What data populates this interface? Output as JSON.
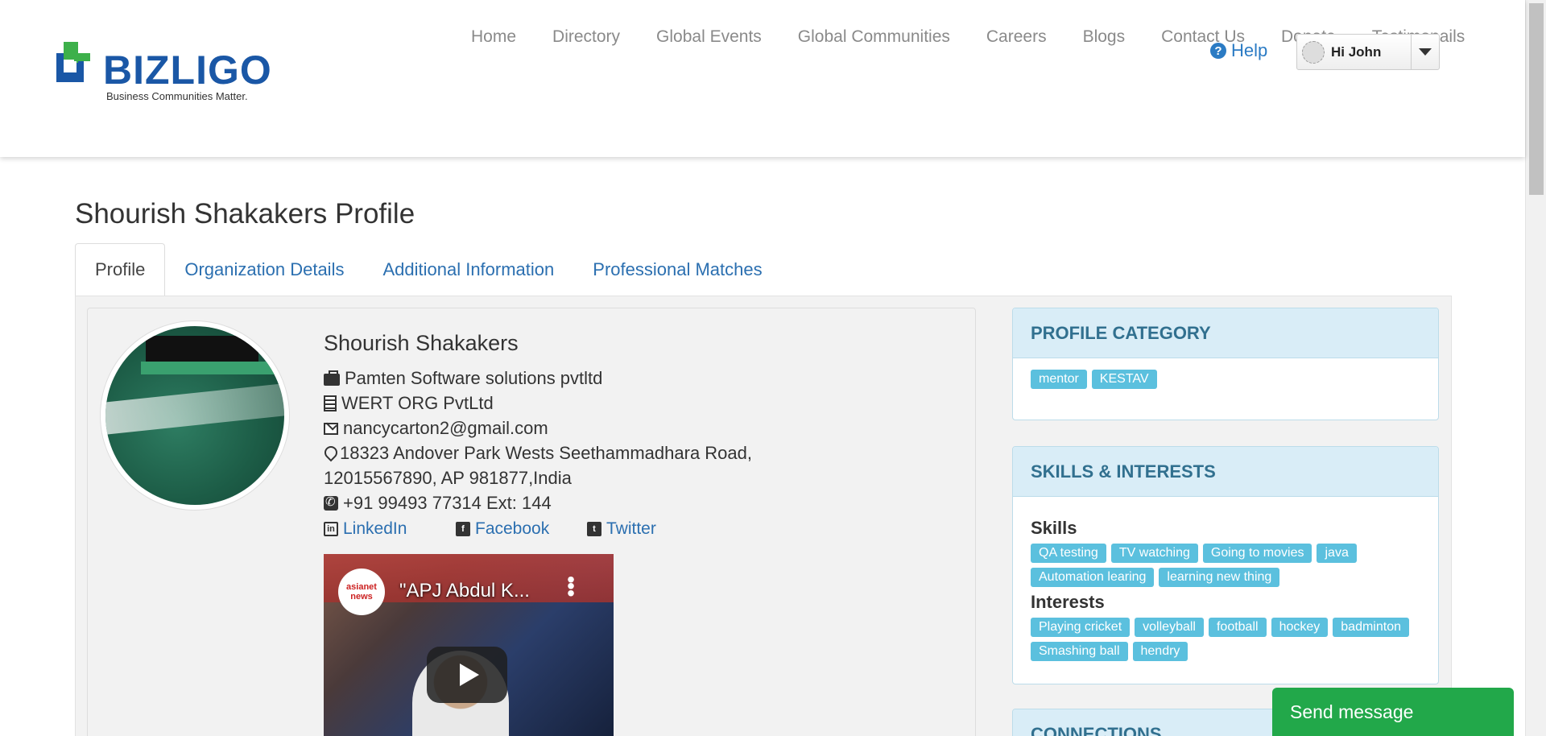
{
  "brand": {
    "name": "BIZLIGO",
    "tagline": "Business Communities Matter."
  },
  "nav": [
    "Home",
    "Directory",
    "Global Events",
    "Global Communities",
    "Careers",
    "Blogs",
    "Contact Us",
    "Donate",
    "Testimonails"
  ],
  "help_label": "Help",
  "user_menu": {
    "greeting": "Hi John"
  },
  "page_title": "Shourish Shakakers Profile",
  "tabs": [
    "Profile",
    "Organization Details",
    "Additional Information",
    "Professional Matches"
  ],
  "profile": {
    "name": "Shourish Shakakers",
    "company": "Pamten Software solutions pvtltd",
    "organization": "WERT ORG PvtLtd",
    "email": "nancycarton2@gmail.com",
    "address_line1": "18323 Andover Park Wests Seethammadhara Road,",
    "address_line2": "12015567890, AP 981877,India",
    "phone": "+91 99493 77314 Ext: 144",
    "social": {
      "linkedin": "LinkedIn",
      "facebook": "Facebook",
      "twitter": "Twitter"
    }
  },
  "video": {
    "title": "\"APJ Abdul K...",
    "channel": "asianet news"
  },
  "profile_category": {
    "heading": "PROFILE CATEGORY",
    "tags": [
      "mentor",
      "KESTAV"
    ]
  },
  "skills_interests": {
    "heading": "SKILLS & INTERESTS",
    "skills_label": "Skills",
    "skills": [
      "QA testing",
      "TV watching",
      "Going to movies",
      "java",
      "Automation learing",
      "learning new thing"
    ],
    "interests_label": "Interests",
    "interests": [
      "Playing cricket",
      "volleyball",
      "football",
      "hockey",
      "badminton",
      "Smashing ball",
      "hendry"
    ]
  },
  "connections": {
    "heading": "CONNECTIONS"
  },
  "send_message": "Send message",
  "colors": {
    "accent_link": "#2b6fb0",
    "tag": "#5bc0de",
    "panel_head": "#d9edf7",
    "send_button": "#22a84a"
  }
}
